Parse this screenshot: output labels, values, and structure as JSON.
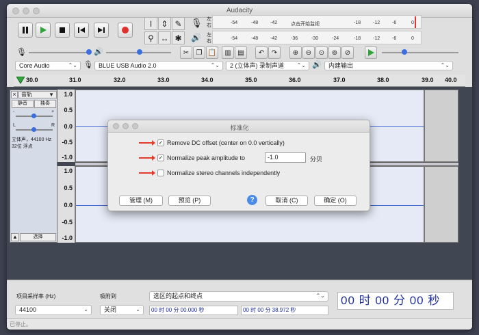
{
  "window": {
    "title": "Audacity"
  },
  "meters": {
    "record_scale": [
      "-54",
      "-48",
      "-42",
      "点击开始监视",
      "-18",
      "-12",
      "-6",
      "0"
    ],
    "play_scale": [
      "-54",
      "-48",
      "-42",
      "-36",
      "-30",
      "-24",
      "-18",
      "-12",
      "-6",
      "0"
    ],
    "lr_top": [
      "左",
      "右"
    ],
    "lr_bottom": [
      "左",
      "右"
    ]
  },
  "devices": {
    "host": "Core Audio",
    "input": "BLUE USB Audio 2.0",
    "channels": "2 (立体声) 录制声道",
    "output": "内建输出"
  },
  "ruler": {
    "ticks": [
      "30.0",
      "31.0",
      "32.0",
      "33.0",
      "34.0",
      "35.0",
      "36.0",
      "37.0",
      "38.0",
      "39.0",
      "40.0"
    ]
  },
  "track": {
    "name": "音轨",
    "mute": "静音",
    "solo": "独奏",
    "gain_minus": "-",
    "gain_plus": "+",
    "pan_left": "L",
    "pan_right": "R",
    "info_line1": "立体声，44100 Hz",
    "info_line2": "32位 浮点",
    "select": "选择"
  },
  "axis": {
    "labels": [
      "1.0",
      "0.5",
      "0.0",
      "-0.5",
      "-1.0"
    ]
  },
  "dialog": {
    "title": "标准化",
    "opt1": "Remove DC offset (center on 0.0 vertically)",
    "opt2": "Normalize peak amplitude to",
    "opt2_value": "-1.0",
    "opt2_unit": "分贝",
    "opt3": "Normalize stereo channels independently",
    "manage": "管理 (M)",
    "preview": "预览 (P)",
    "help": "?",
    "cancel": "取消 (C)",
    "ok": "确定 (O)"
  },
  "bottom": {
    "rate_label": "项目采样率 (Hz)",
    "rate_value": "44100",
    "snap_label": "吸附到",
    "snap_value": "关闭",
    "selection_mode": "选区的起点和终点",
    "start_time": "00 时 00 分 00.000 秒",
    "end_time": "00 时 00 分 38.972 秒",
    "big_time": "00 时 00 分 00 秒"
  },
  "status": {
    "text": "已停止。"
  },
  "colors": {
    "accent_blue": "#3b6fe0",
    "record_red": "#e0302a",
    "play_green": "#2fa43a",
    "annotation_red": "#e23b2b",
    "waveform": "#3c5fd0"
  }
}
